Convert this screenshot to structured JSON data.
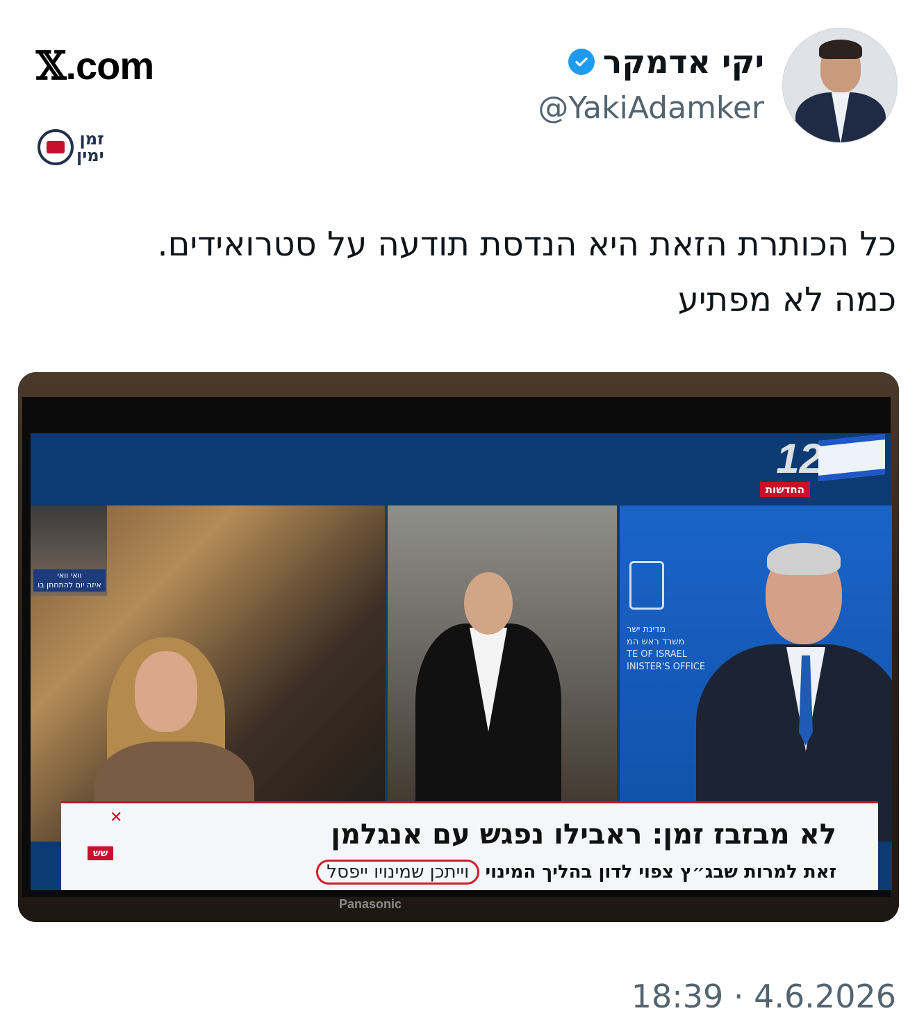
{
  "site": {
    "logo_x": "𝕏",
    "logo_rest": ".com"
  },
  "watermark": {
    "line1": "זמן",
    "line2": "ימין"
  },
  "author": {
    "name": "יקי אדמקר",
    "handle": "@YakiAdamker",
    "verified": true,
    "verified_icon": "verified-badge-icon"
  },
  "tweet": {
    "lines": [
      "כל הכותרת הזאת היא הנדסת תודעה על סטרואידים.",
      "כמה לא מפתיע"
    ]
  },
  "media": {
    "channel_number": "12",
    "channel_tag": "החדשות",
    "mini_tag_line1": "וואי וואי",
    "mini_tag_line2": "איזה יום להתחתן בו",
    "pm_line1": "מדינת ישר",
    "pm_line2": "משרד ראש המ",
    "pm_line3": "TE OF ISRAEL",
    "pm_line4": "INISTER'S OFFICE",
    "headline": "לא מבזבז זמן: ראבילו נפגש עם אנגלמן",
    "sub_prefix": "זאת למרות שבג״ץ צפוי לדון בהליך המינוי",
    "sub_highlight": "וייתכן שמינויו ייפסל",
    "sh_tag": "שש",
    "brand": "Panasonic",
    "colors": {
      "ticker_accent": "#c8102e",
      "highlight_circle": "#d11a2a",
      "pm_backdrop": "#1a64c8"
    }
  },
  "timestamp": "18:39 · 4.6.2026"
}
